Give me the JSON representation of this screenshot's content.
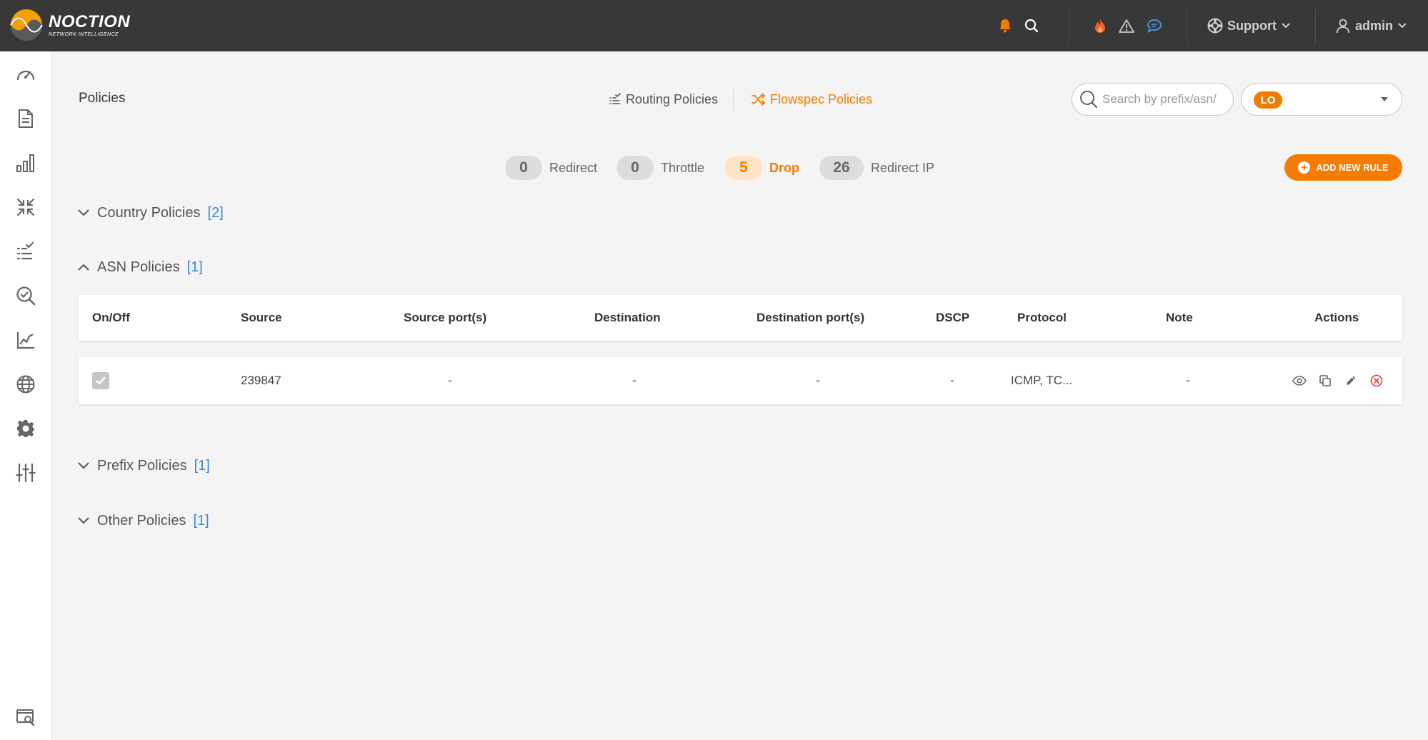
{
  "app": {
    "logo_title": "NOCTION",
    "logo_subtitle": "NETWORK INTELLIGENCE"
  },
  "topbar": {
    "support_label": "Support",
    "user_label": "admin",
    "icons": [
      "bell-icon",
      "search-icon",
      "fire-icon",
      "warning-icon",
      "chat-icon",
      "lifebuoy-icon",
      "user-icon"
    ]
  },
  "sidebar": {
    "items": [
      "dashboard-icon",
      "reports-icon",
      "bar-chart-icon",
      "collapse-arrows-icon",
      "policies-list-icon",
      "search-check-icon",
      "line-chart-icon",
      "globe-icon",
      "settings-icon",
      "sliders-icon",
      "monitor-search-icon"
    ]
  },
  "page": {
    "title": "Policies",
    "tabs": {
      "routing": "Routing Policies",
      "flowspec": "Flowspec Policies"
    },
    "search_placeholder": "Search by prefix/asn/",
    "select_badge": "LO"
  },
  "counters": [
    {
      "value": "0",
      "label": "Redirect",
      "active": false
    },
    {
      "value": "0",
      "label": "Throttle",
      "active": false
    },
    {
      "value": "5",
      "label": "Drop",
      "active": true
    },
    {
      "value": "26",
      "label": "Redirect IP",
      "active": false
    }
  ],
  "add_rule_label": "ADD NEW RULE",
  "sections": {
    "country": {
      "title": "Country Policies",
      "count": "[2]"
    },
    "asn": {
      "title": "ASN Policies",
      "count": "[1]"
    },
    "prefix": {
      "title": "Prefix Policies",
      "count": "[1]"
    },
    "other": {
      "title": "Other Policies",
      "count": "[1]"
    }
  },
  "table": {
    "headers": [
      "On/Off",
      "Source",
      "Source port(s)",
      "Destination",
      "Destination port(s)",
      "DSCP",
      "Protocol",
      "Note",
      "Actions"
    ],
    "rows": [
      {
        "enabled": true,
        "source": "239847",
        "source_ports": "-",
        "destination": "-",
        "destination_ports": "-",
        "dscp": "-",
        "protocol": "ICMP, TC...",
        "note": "-"
      }
    ]
  },
  "colors": {
    "accent": "#f57c00",
    "topbar": "#383838",
    "link_count": "#3a86d4",
    "danger": "#e53935"
  }
}
